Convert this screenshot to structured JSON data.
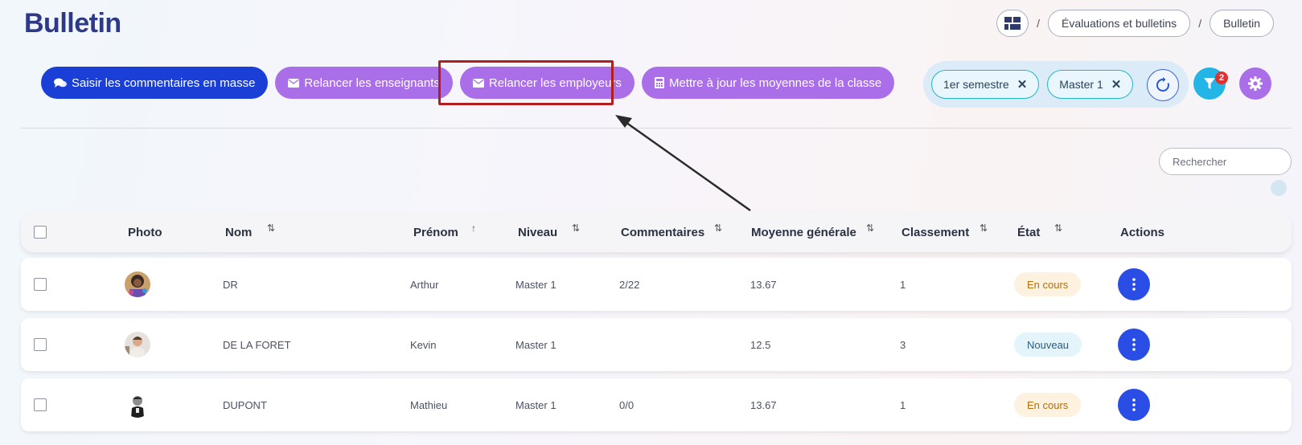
{
  "page": {
    "title": "Bulletin"
  },
  "breadcrumb": {
    "separator": "/",
    "items": [
      "Évaluations et bulletins",
      "Bulletin"
    ]
  },
  "toolbar": {
    "buttons": [
      {
        "label": "Saisir les commentaires en masse",
        "icon": "comments-icon",
        "color": "#1a3fd6"
      },
      {
        "label": "Relancer les enseignants",
        "icon": "envelope-icon",
        "color": "#a96ee8"
      },
      {
        "label": "Relancer les employeurs",
        "icon": "envelope-icon",
        "color": "#a96ee8",
        "highlighted": true
      },
      {
        "label": "Mettre à jour les moyennes de la classe",
        "icon": "calculator-icon",
        "color": "#a96ee8"
      }
    ]
  },
  "filters": {
    "chips": [
      "1er semestre",
      "Master 1"
    ],
    "active_count": "2"
  },
  "search": {
    "placeholder": "Rechercher",
    "value": ""
  },
  "table": {
    "columns": [
      "Photo",
      "Nom",
      "Prénom",
      "Niveau",
      "Commentaires",
      "Moyenne générale",
      "Classement",
      "État",
      "Actions"
    ],
    "sort": {
      "Prénom": "ascending"
    },
    "rows": [
      {
        "nom": "DR",
        "prenom": "Arthur",
        "niveau": "Master 1",
        "commentaires": "2/22",
        "moyenne": "13.67",
        "classement": "1",
        "etat": "En cours",
        "etat_style": "orange"
      },
      {
        "nom": "DE LA FORET",
        "prenom": "Kevin",
        "niveau": "Master 1",
        "commentaires": "",
        "moyenne": "12.5",
        "classement": "3",
        "etat": "Nouveau",
        "etat_style": "blue"
      },
      {
        "nom": "DUPONT",
        "prenom": "Mathieu",
        "niveau": "Master 1",
        "commentaires": "0/0",
        "moyenne": "13.67",
        "classement": "1",
        "etat": "En cours",
        "etat_style": "orange"
      }
    ]
  },
  "colors": {
    "title": "#2e3a87",
    "primary": "#1a3fd6",
    "purple": "#a96ee8",
    "accent_cyan": "#23b5e5",
    "highlight": "#b01e1e"
  }
}
